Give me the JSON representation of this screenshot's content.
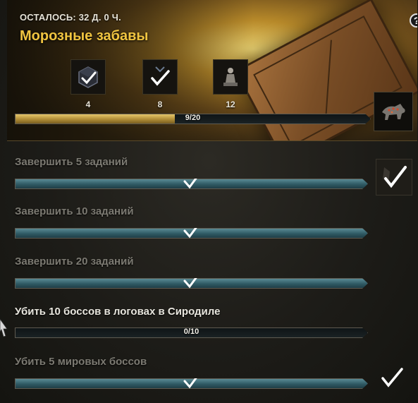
{
  "header": {
    "remaining": "ОСТАЛОСЬ: 32 Д. 0 Ч.",
    "title": "Морозные забавы",
    "help_label": "?"
  },
  "rewards": [
    {
      "icon": "dye-box-icon",
      "count": "4"
    },
    {
      "icon": "checkmark-icon",
      "count": "8"
    },
    {
      "icon": "statue-icon",
      "count": "12"
    }
  ],
  "overall_progress": {
    "text": "9/20",
    "current": 9,
    "total": 20
  },
  "tasks": [
    {
      "label": "Завершить 5 заданий",
      "progress_text": "",
      "completed": true
    },
    {
      "label": "Завершить 10 заданий",
      "progress_text": "",
      "completed": true
    },
    {
      "label": "Завершить 20 заданий",
      "progress_text": "",
      "completed": true
    },
    {
      "label": "Убить 10 боссов в логовах в Сиродиле",
      "progress_text": "0/10",
      "completed": false
    },
    {
      "label": "Убить 5 мировых боссов",
      "progress_text": "",
      "completed": true
    }
  ],
  "colors": {
    "title_gold": "#f0c440",
    "progress_gold": "#c9a54a",
    "progress_teal": "#3c6a74"
  }
}
